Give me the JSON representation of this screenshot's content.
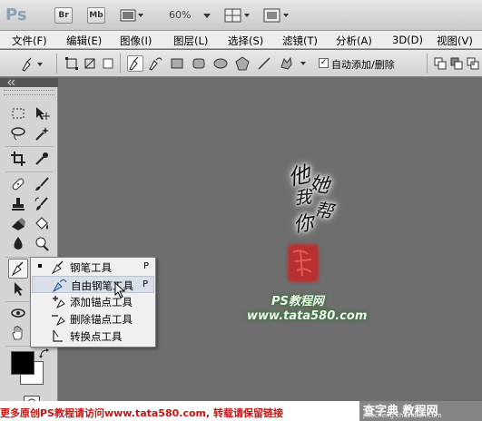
{
  "appbar": {
    "logo": "Ps",
    "btn_br": "Br",
    "btn_mb": "Mb",
    "zoom": "60%"
  },
  "menu": [
    "文件(F)",
    "编辑(E)",
    "图像(I)",
    "图层(L)",
    "选择(S)",
    "滤镜(T)",
    "分析(A)",
    "3D(D)",
    "视图(V)"
  ],
  "options": {
    "auto_add_delete_label": "自动添加/删除",
    "auto_add_delete_checked": true
  },
  "flyout": {
    "items": [
      {
        "label": "钢笔工具",
        "key": "P",
        "current": true,
        "icon": "pen-icon"
      },
      {
        "label": "自由钢笔工具",
        "key": "P",
        "current": false,
        "icon": "freeform-pen-icon",
        "highlighted": true
      },
      {
        "label": "添加锚点工具",
        "key": "",
        "current": false,
        "icon": "add-anchor-icon"
      },
      {
        "label": "删除锚点工具",
        "key": "",
        "current": false,
        "icon": "delete-anchor-icon"
      },
      {
        "label": "转换点工具",
        "key": "",
        "current": false,
        "icon": "convert-point-icon"
      }
    ]
  },
  "artwork": {
    "calligraphy": [
      "他",
      "她",
      "我",
      "帮",
      "你"
    ],
    "seal_color": "#d21a1a",
    "watermark_site_name": "PS教程网",
    "watermark_url": "www.tata580.com"
  },
  "footer": {
    "notice": "更多原创PS教程请访问www.tata580.com, 转载请保留链接",
    "logo_main": "查字典 教程网",
    "logo_sub": "jiaocheng.chazidian.com"
  },
  "colors": {
    "foreground": "#000000",
    "background": "#ffffff",
    "canvas": "#6e6e6e"
  }
}
